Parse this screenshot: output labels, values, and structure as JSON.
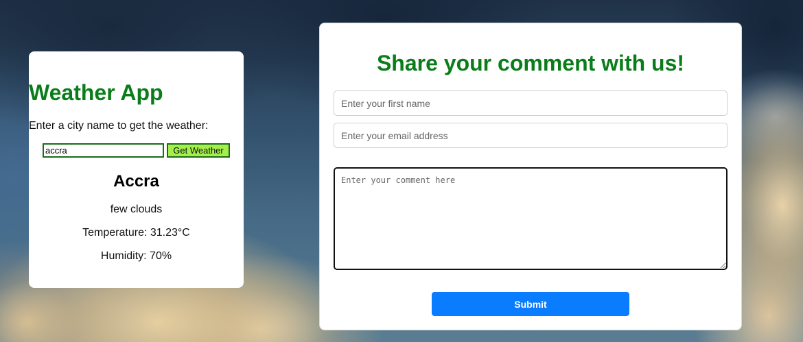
{
  "colors": {
    "title_green": "#0a7d1a",
    "button_green": "#a4f04a",
    "submit_blue": "#0a7cff"
  },
  "weather": {
    "title": "Weather App",
    "prompt": "Enter a city name to get the weather:",
    "city_input_value": "accra",
    "button_label": "Get Weather",
    "city": "Accra",
    "description": "few clouds",
    "temperature": "Temperature: 31.23°C",
    "humidity": "Humidity: 70%"
  },
  "comment": {
    "title": "Share your comment with us!",
    "first_name_placeholder": "Enter your first name",
    "email_placeholder": "Enter your email address",
    "comment_placeholder": "Enter your comment here",
    "submit_label": "Submit"
  }
}
